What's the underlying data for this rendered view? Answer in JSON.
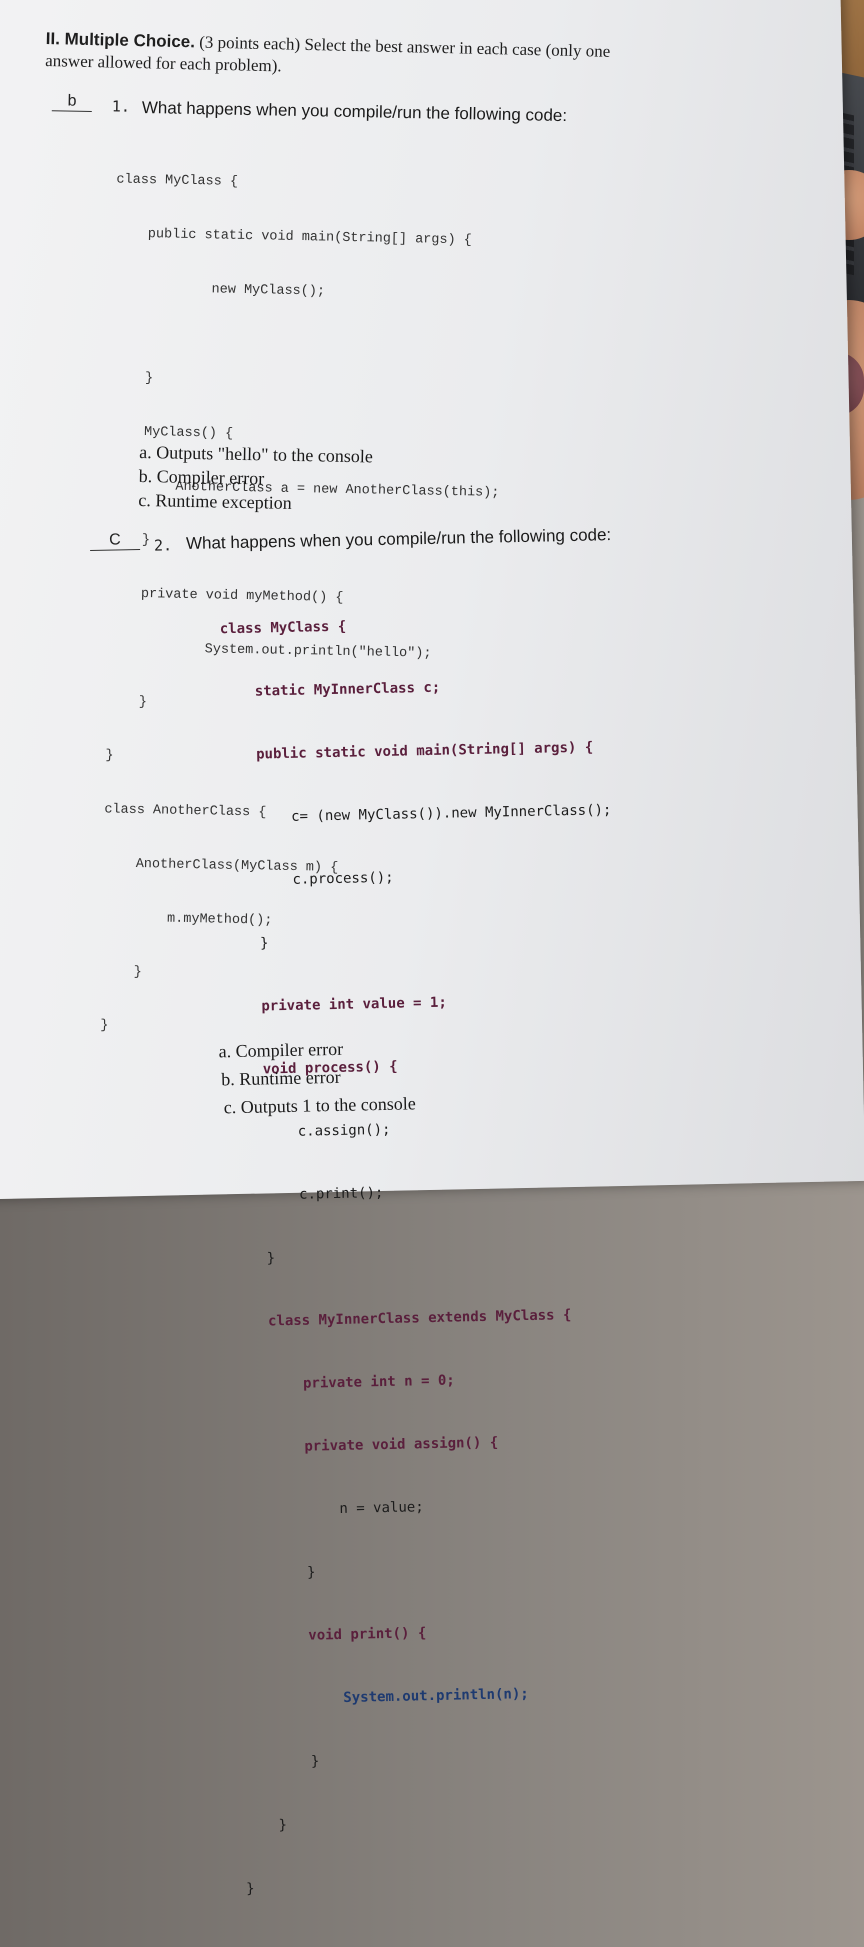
{
  "header": {
    "title_bold": "II. Multiple Choice.",
    "line1_rest": "(3 points each) Select the best answer in each case (only one",
    "line2": "answer allowed for each problem)."
  },
  "q1": {
    "answer": "b",
    "number": "1.",
    "question": "What happens when you compile/run the following code:",
    "code": [
      "class MyClass {",
      "    public static void main(String[] args) {",
      "            new MyClass();",
      "",
      "    }",
      "    MyClass() {",
      "        AnotherClass a = new AnotherClass(this);",
      "    }",
      "    private void myMethod() {",
      "            System.out.println(\"hello\");",
      "    }",
      "}",
      "class AnotherClass {",
      "    AnotherClass(MyClass m) {",
      "        m.myMethod();",
      "    }",
      "}"
    ],
    "options": [
      {
        "letter": "a.",
        "text": "Outputs \"hello\" to the console"
      },
      {
        "letter": "b.",
        "text": "Compiler error"
      },
      {
        "letter": "c.",
        "text": "Runtime exception"
      }
    ]
  },
  "q2": {
    "answer": "C",
    "number": "2.",
    "question": "What happens when you compile/run the following code:",
    "code": [
      "class MyClass {",
      "    static MyInnerClass c;",
      "    public static void main(String[] args) {",
      "        c= (new MyClass()).new MyInnerClass();",
      "        c.process();",
      "    }",
      "    private int value = 1;",
      "    void process() {",
      "        c.assign();",
      "        c.print();",
      "    }",
      "    class MyInnerClass extends MyClass {",
      "        private int n = 0;",
      "        private void assign() {",
      "            n = value;",
      "        }",
      "        void print() {",
      "            System.out.println(n);",
      "        }",
      "    }",
      "}"
    ],
    "options": [
      {
        "letter": "a.",
        "text": "Compiler error"
      },
      {
        "letter": "b.",
        "text": "Runtime error"
      },
      {
        "letter": "c.",
        "text": "Outputs 1 to the console"
      }
    ]
  }
}
